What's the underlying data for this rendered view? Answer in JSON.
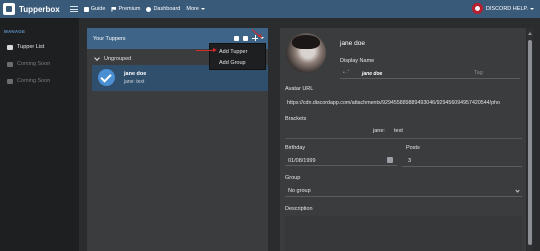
{
  "navbar": {
    "brand": "Tupperbox",
    "links": [
      {
        "label": "Guide",
        "icon": "book-icon"
      },
      {
        "label": "Premium",
        "icon": "flag-icon"
      },
      {
        "label": "Dashboard",
        "icon": "dashboard-icon"
      },
      {
        "label": "More",
        "icon": "chevron-down-icon"
      }
    ],
    "user": "DISCORD HELP.",
    "accent": "#3a5a7a"
  },
  "sidebar": {
    "header": "MANAGE",
    "items": [
      {
        "label": "Tupper List",
        "state": "active"
      },
      {
        "label": "Coming Soon",
        "state": "disabled"
      },
      {
        "label": "Coming Soon",
        "state": "disabled"
      }
    ]
  },
  "tuppers_panel": {
    "title": "Your Tuppers",
    "group": "Ungrouped",
    "tupper": {
      "name": "jane doe",
      "brackets": "jane: text"
    },
    "dropdown": [
      "Add Tupper",
      "Add Group"
    ]
  },
  "editor": {
    "name": "jane doe",
    "display_name_label": "Display Name",
    "display_name_prefix": "• ·˚",
    "display_name_value": "jane doe",
    "tag_placeholder": "Tag",
    "avatar_url_label": "Avatar URL",
    "avatar_url": "https://cdn.discordapp.com/attachments/929455889889493046/929456094957420544/pho",
    "brackets_label": "Brackets",
    "bracket_prefix": "jane:",
    "bracket_suffix": "text",
    "birthday_label": "Birthday",
    "birthday": "01/08/1999",
    "posts_label": "Posts",
    "posts": "3",
    "group_label": "Group",
    "group_value": "No group",
    "description_label": "Description"
  }
}
